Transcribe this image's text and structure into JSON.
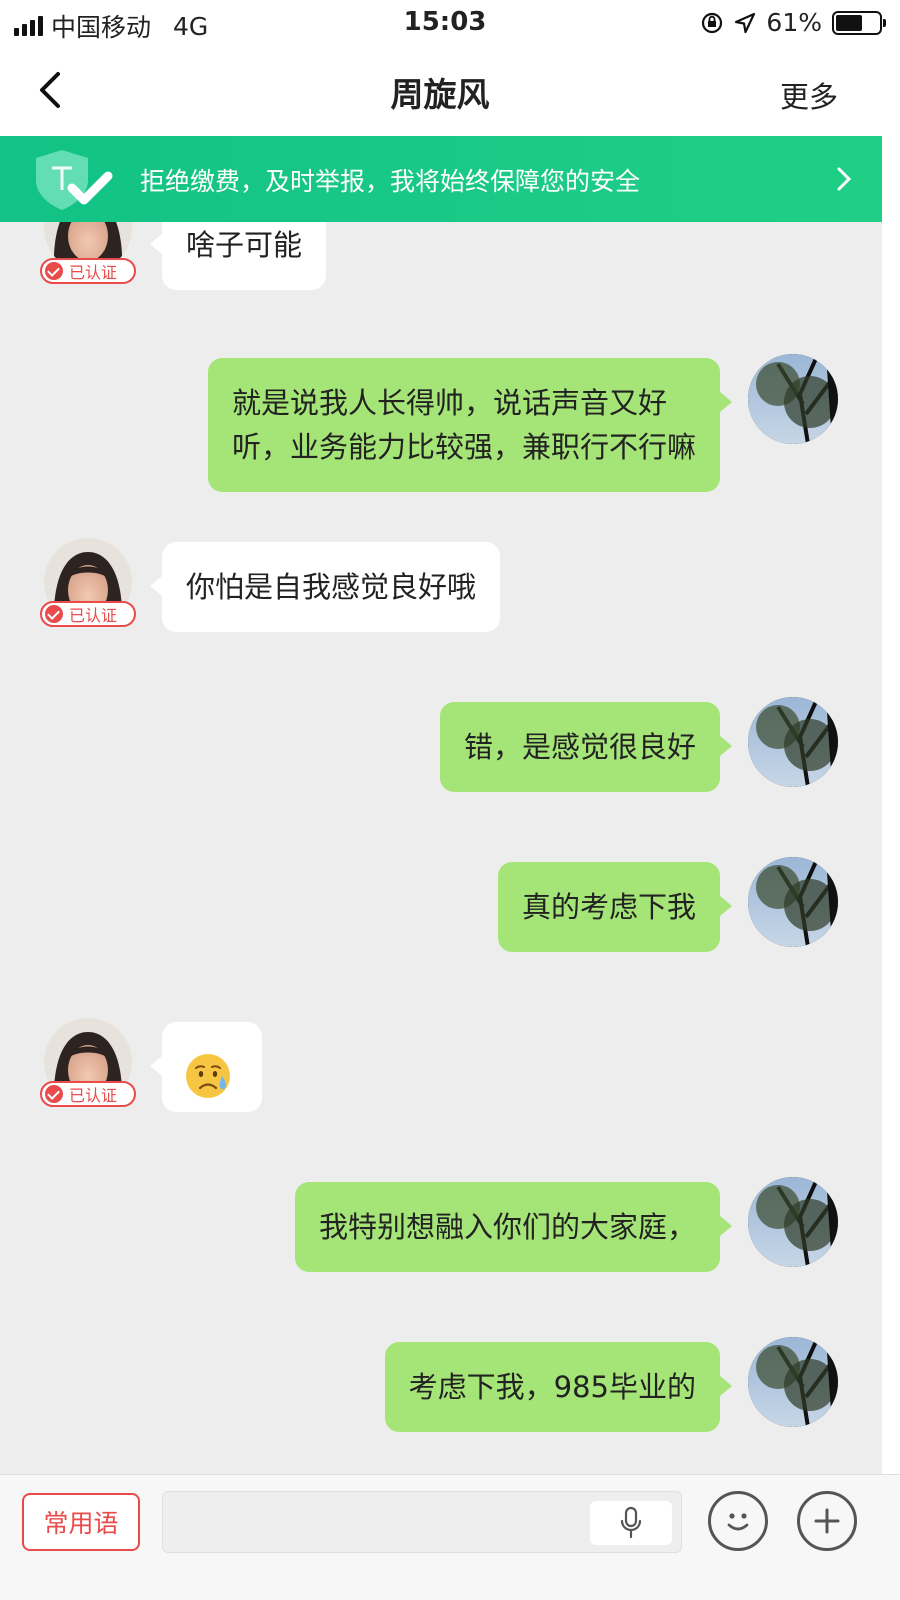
{
  "status_bar": {
    "carrier": "中国移动",
    "network": "4G",
    "time": "15:03",
    "battery_percent": "61%",
    "battery_level": 0.61,
    "icons": [
      "signal-icon",
      "orientation-lock-icon",
      "location-icon",
      "battery-icon"
    ]
  },
  "nav": {
    "title": "周旋风",
    "more_label": "更多",
    "back_icon": "chevron-left-icon"
  },
  "banner": {
    "text": "拒绝缴费，及时举报，我将始终保障您的安全",
    "icon": "shield-check-icon",
    "arrow_icon": "chevron-right-icon"
  },
  "verified_label": "已认证",
  "messages": [
    {
      "side": "in",
      "text": "啥子可能"
    },
    {
      "side": "out",
      "lines": [
        "就是说我人长得帅，说话声音又好",
        "听，业务能力比较强，兼职行不行嘛"
      ]
    },
    {
      "side": "in",
      "text": "你怕是自我感觉良好哦"
    },
    {
      "side": "out",
      "text": "错，是感觉很良好"
    },
    {
      "side": "out",
      "text": "真的考虑下我"
    },
    {
      "side": "in",
      "emoji": "sad-sweat-emoji"
    },
    {
      "side": "out",
      "text": "我特别想融入你们的大家庭，"
    },
    {
      "side": "out",
      "text": "考虑下我，985毕业的"
    }
  ],
  "input_bar": {
    "phrases_label": "常用语",
    "input_value": "",
    "icons": [
      "microphone-icon",
      "smiley-icon",
      "plus-icon"
    ]
  }
}
